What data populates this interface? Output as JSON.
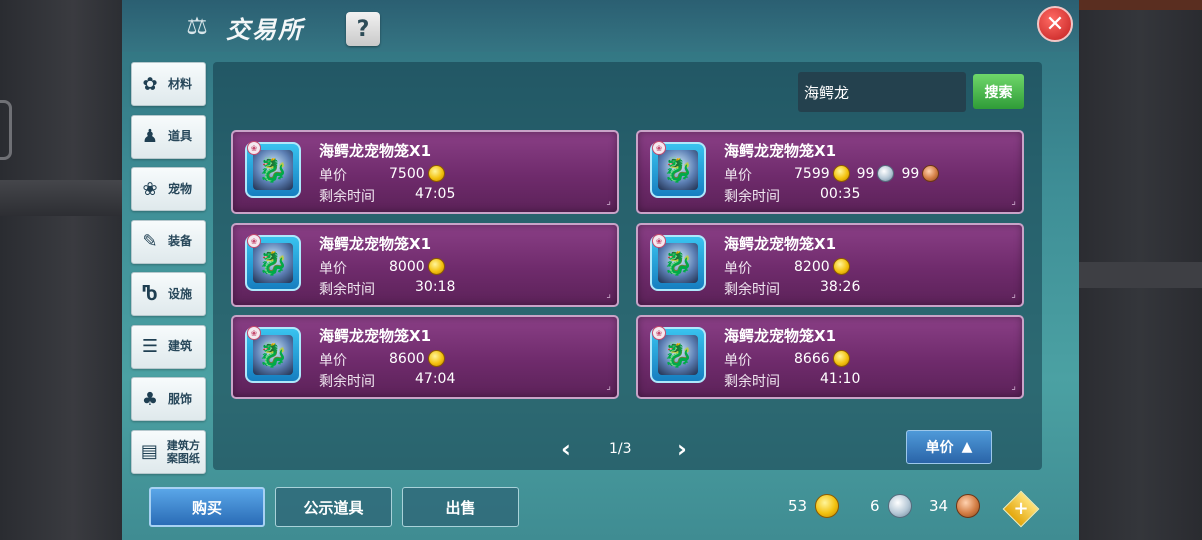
{
  "header": {
    "title": "交易所",
    "help_label": "?",
    "close_label": "✕"
  },
  "sidebar": {
    "items": [
      {
        "label": "材料",
        "icon": "materials-icon",
        "glyph": "✿"
      },
      {
        "label": "道具",
        "icon": "props-icon",
        "glyph": "♟"
      },
      {
        "label": "宠物",
        "icon": "pet-paw-icon",
        "glyph": "❀"
      },
      {
        "label": "装备",
        "icon": "equipment-icon",
        "glyph": "✎"
      },
      {
        "label": "设施",
        "icon": "facility-icon",
        "glyph": "Ⴊ"
      },
      {
        "label": "建筑",
        "icon": "building-icon",
        "glyph": "☰"
      },
      {
        "label": "服饰",
        "icon": "clothing-icon",
        "glyph": "♣"
      },
      {
        "label": "建筑方案图纸",
        "icon": "blueprint-icon",
        "glyph": "▤"
      }
    ]
  },
  "search": {
    "value": "海鳄龙",
    "button_label": "搜索"
  },
  "listings": [
    {
      "name": "海鳄龙宠物笼X1",
      "price_label": "单价",
      "price": "7500",
      "time_label": "剩余时间",
      "time": "47:05",
      "extra": null
    },
    {
      "name": "海鳄龙宠物笼X1",
      "price_label": "单价",
      "price": "7599",
      "time_label": "剩余时间",
      "time": "00:35",
      "extra": {
        "silver": "99",
        "bronze": "99"
      }
    },
    {
      "name": "海鳄龙宠物笼X1",
      "price_label": "单价",
      "price": "8000",
      "time_label": "剩余时间",
      "time": "30:18",
      "extra": null
    },
    {
      "name": "海鳄龙宠物笼X1",
      "price_label": "单价",
      "price": "8200",
      "time_label": "剩余时间",
      "time": "38:26",
      "extra": null
    },
    {
      "name": "海鳄龙宠物笼X1",
      "price_label": "单价",
      "price": "8600",
      "time_label": "剩余时间",
      "time": "47:04",
      "extra": null
    },
    {
      "name": "海鳄龙宠物笼X1",
      "price_label": "单价",
      "price": "8666",
      "time_label": "剩余时间",
      "time": "41:10",
      "extra": null
    }
  ],
  "pager": {
    "text": "1/3",
    "prev": "‹",
    "next": "›"
  },
  "sort": {
    "label": "单价",
    "arrow": "▲"
  },
  "actions": {
    "buy": "购买",
    "public_items": "公示道具",
    "sell": "出售"
  },
  "wallet": {
    "gold": "53",
    "silver": "6",
    "bronze": "34",
    "add_label": "+"
  },
  "colors": {
    "panel": "#3e8e96",
    "card": "#7a327a",
    "search_button": "#2f9c38",
    "close_button": "#c21f20"
  }
}
